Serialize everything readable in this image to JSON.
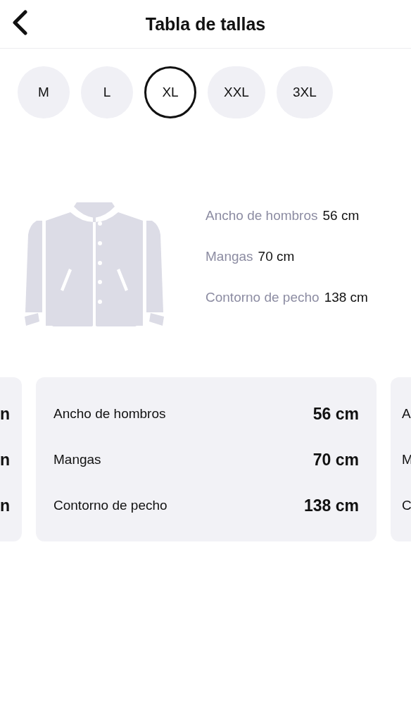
{
  "header": {
    "title": "Tabla de tallas"
  },
  "sizes": [
    {
      "label": "M",
      "selected": false
    },
    {
      "label": "L",
      "selected": false
    },
    {
      "label": "XL",
      "selected": true
    },
    {
      "label": "XXL",
      "selected": false
    },
    {
      "label": "3XL",
      "selected": false
    }
  ],
  "summary": [
    {
      "label": "Ancho de hombros",
      "value": "56 cm"
    },
    {
      "label": "Mangas",
      "value": "70 cm"
    },
    {
      "label": "Contorno de pecho",
      "value": "138 cm"
    }
  ],
  "cards": [
    {
      "kind": "peek_left",
      "values": [
        "n",
        "n",
        "n"
      ]
    },
    {
      "kind": "full",
      "rows": [
        {
          "label": "Ancho de hombros",
          "value": "56 cm"
        },
        {
          "label": "Mangas",
          "value": "70 cm"
        },
        {
          "label": "Contorno de pecho",
          "value": "138 cm"
        }
      ]
    },
    {
      "kind": "peek_right",
      "labels": [
        "A",
        "M",
        "C"
      ]
    }
  ]
}
